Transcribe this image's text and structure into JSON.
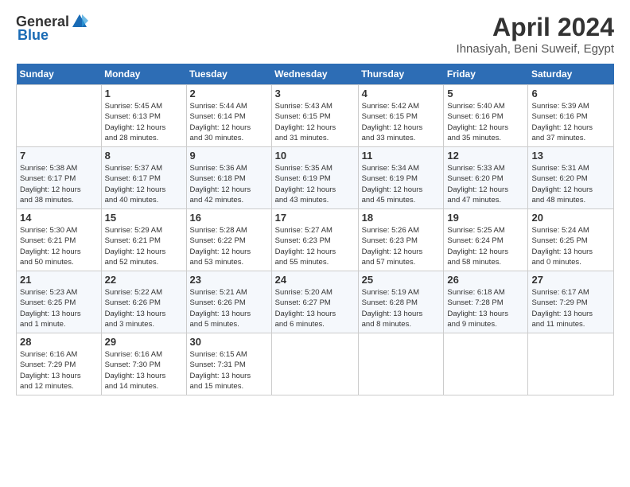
{
  "header": {
    "logo_general": "General",
    "logo_blue": "Blue",
    "title": "April 2024",
    "location": "Ihnasiyah, Beni Suweif, Egypt"
  },
  "columns": [
    "Sunday",
    "Monday",
    "Tuesday",
    "Wednesday",
    "Thursday",
    "Friday",
    "Saturday"
  ],
  "weeks": [
    [
      {
        "day": "",
        "info": ""
      },
      {
        "day": "1",
        "info": "Sunrise: 5:45 AM\nSunset: 6:13 PM\nDaylight: 12 hours\nand 28 minutes."
      },
      {
        "day": "2",
        "info": "Sunrise: 5:44 AM\nSunset: 6:14 PM\nDaylight: 12 hours\nand 30 minutes."
      },
      {
        "day": "3",
        "info": "Sunrise: 5:43 AM\nSunset: 6:15 PM\nDaylight: 12 hours\nand 31 minutes."
      },
      {
        "day": "4",
        "info": "Sunrise: 5:42 AM\nSunset: 6:15 PM\nDaylight: 12 hours\nand 33 minutes."
      },
      {
        "day": "5",
        "info": "Sunrise: 5:40 AM\nSunset: 6:16 PM\nDaylight: 12 hours\nand 35 minutes."
      },
      {
        "day": "6",
        "info": "Sunrise: 5:39 AM\nSunset: 6:16 PM\nDaylight: 12 hours\nand 37 minutes."
      }
    ],
    [
      {
        "day": "7",
        "info": "Sunrise: 5:38 AM\nSunset: 6:17 PM\nDaylight: 12 hours\nand 38 minutes."
      },
      {
        "day": "8",
        "info": "Sunrise: 5:37 AM\nSunset: 6:17 PM\nDaylight: 12 hours\nand 40 minutes."
      },
      {
        "day": "9",
        "info": "Sunrise: 5:36 AM\nSunset: 6:18 PM\nDaylight: 12 hours\nand 42 minutes."
      },
      {
        "day": "10",
        "info": "Sunrise: 5:35 AM\nSunset: 6:19 PM\nDaylight: 12 hours\nand 43 minutes."
      },
      {
        "day": "11",
        "info": "Sunrise: 5:34 AM\nSunset: 6:19 PM\nDaylight: 12 hours\nand 45 minutes."
      },
      {
        "day": "12",
        "info": "Sunrise: 5:33 AM\nSunset: 6:20 PM\nDaylight: 12 hours\nand 47 minutes."
      },
      {
        "day": "13",
        "info": "Sunrise: 5:31 AM\nSunset: 6:20 PM\nDaylight: 12 hours\nand 48 minutes."
      }
    ],
    [
      {
        "day": "14",
        "info": "Sunrise: 5:30 AM\nSunset: 6:21 PM\nDaylight: 12 hours\nand 50 minutes."
      },
      {
        "day": "15",
        "info": "Sunrise: 5:29 AM\nSunset: 6:21 PM\nDaylight: 12 hours\nand 52 minutes."
      },
      {
        "day": "16",
        "info": "Sunrise: 5:28 AM\nSunset: 6:22 PM\nDaylight: 12 hours\nand 53 minutes."
      },
      {
        "day": "17",
        "info": "Sunrise: 5:27 AM\nSunset: 6:23 PM\nDaylight: 12 hours\nand 55 minutes."
      },
      {
        "day": "18",
        "info": "Sunrise: 5:26 AM\nSunset: 6:23 PM\nDaylight: 12 hours\nand 57 minutes."
      },
      {
        "day": "19",
        "info": "Sunrise: 5:25 AM\nSunset: 6:24 PM\nDaylight: 12 hours\nand 58 minutes."
      },
      {
        "day": "20",
        "info": "Sunrise: 5:24 AM\nSunset: 6:25 PM\nDaylight: 13 hours\nand 0 minutes."
      }
    ],
    [
      {
        "day": "21",
        "info": "Sunrise: 5:23 AM\nSunset: 6:25 PM\nDaylight: 13 hours\nand 1 minute."
      },
      {
        "day": "22",
        "info": "Sunrise: 5:22 AM\nSunset: 6:26 PM\nDaylight: 13 hours\nand 3 minutes."
      },
      {
        "day": "23",
        "info": "Sunrise: 5:21 AM\nSunset: 6:26 PM\nDaylight: 13 hours\nand 5 minutes."
      },
      {
        "day": "24",
        "info": "Sunrise: 5:20 AM\nSunset: 6:27 PM\nDaylight: 13 hours\nand 6 minutes."
      },
      {
        "day": "25",
        "info": "Sunrise: 5:19 AM\nSunset: 6:28 PM\nDaylight: 13 hours\nand 8 minutes."
      },
      {
        "day": "26",
        "info": "Sunrise: 6:18 AM\nSunset: 7:28 PM\nDaylight: 13 hours\nand 9 minutes."
      },
      {
        "day": "27",
        "info": "Sunrise: 6:17 AM\nSunset: 7:29 PM\nDaylight: 13 hours\nand 11 minutes."
      }
    ],
    [
      {
        "day": "28",
        "info": "Sunrise: 6:16 AM\nSunset: 7:29 PM\nDaylight: 13 hours\nand 12 minutes."
      },
      {
        "day": "29",
        "info": "Sunrise: 6:16 AM\nSunset: 7:30 PM\nDaylight: 13 hours\nand 14 minutes."
      },
      {
        "day": "30",
        "info": "Sunrise: 6:15 AM\nSunset: 7:31 PM\nDaylight: 13 hours\nand 15 minutes."
      },
      {
        "day": "",
        "info": ""
      },
      {
        "day": "",
        "info": ""
      },
      {
        "day": "",
        "info": ""
      },
      {
        "day": "",
        "info": ""
      }
    ]
  ]
}
